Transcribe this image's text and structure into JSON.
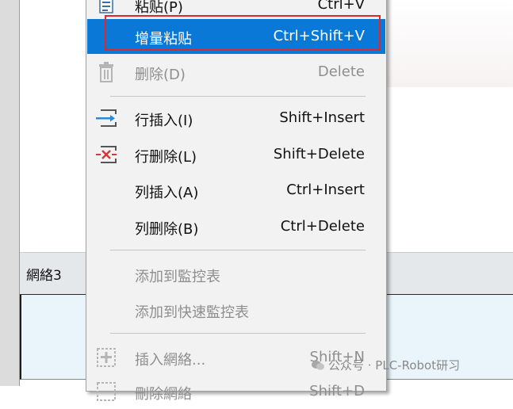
{
  "menu": {
    "items": [
      {
        "id": "paste",
        "label": "粘贴(P)",
        "shortcut": "Ctrl+V",
        "icon": "paste-icon",
        "state": "normal"
      },
      {
        "id": "incremental-paste",
        "label": "增量粘贴",
        "shortcut": "Ctrl+Shift+V",
        "state": "selected"
      },
      {
        "id": "delete",
        "label": "删除(D)",
        "shortcut": "Delete",
        "icon": "trash-icon",
        "state": "disabled"
      },
      {
        "id": "insert-row",
        "label": "行插入(I)",
        "shortcut": "Shift+Insert",
        "icon": "insert-row-icon",
        "state": "normal"
      },
      {
        "id": "delete-row",
        "label": "行删除(L)",
        "shortcut": "Shift+Delete",
        "icon": "delete-row-icon",
        "state": "normal"
      },
      {
        "id": "insert-column",
        "label": "列插入(A)",
        "shortcut": "Ctrl+Insert",
        "state": "normal"
      },
      {
        "id": "delete-column",
        "label": "列删除(B)",
        "shortcut": "Ctrl+Delete",
        "state": "normal"
      },
      {
        "id": "add-to-watch-table",
        "label": "添加到監控表",
        "shortcut": "",
        "state": "disabled"
      },
      {
        "id": "add-to-quick-watch-table",
        "label": "添加到快速監控表",
        "shortcut": "",
        "state": "disabled"
      },
      {
        "id": "insert-network",
        "label": "插入網絡...",
        "shortcut": "Shift+N",
        "icon": "insert-network-icon",
        "state": "disabled"
      },
      {
        "id": "delete-network",
        "label": "刪除網絡",
        "shortcut": "Shift+D",
        "icon": "delete-network-icon",
        "state": "disabled"
      }
    ]
  },
  "editor": {
    "network_label": "網絡3"
  },
  "watermark": {
    "text": "公众号 · PLC-Robot研习"
  },
  "colors": {
    "selection": "#0a78d7",
    "highlight_border": "#e0262d",
    "insert_icon": "#2a8ad6",
    "delete_icon": "#d23a3a"
  }
}
